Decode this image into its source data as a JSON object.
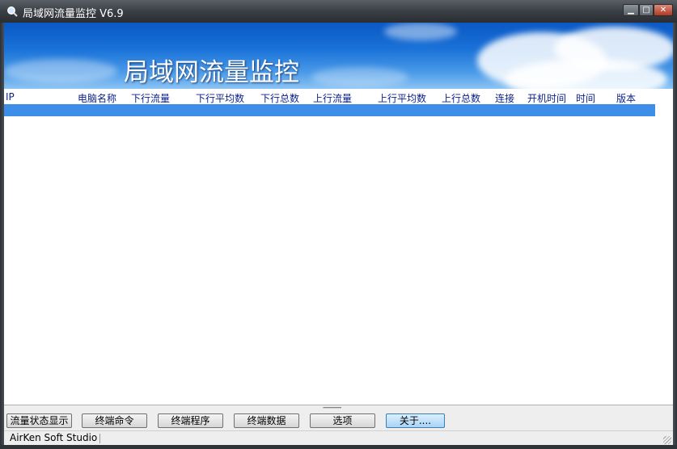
{
  "window": {
    "title": "局域网流量监控 V6.9",
    "controls": {
      "minimize": "▁",
      "maximize": "□",
      "close": "✕"
    }
  },
  "banner": {
    "title": "局域网流量监控"
  },
  "list": {
    "columns": [
      "IP",
      "电脑名称",
      "下行流量",
      "下行平均数",
      "下行总数",
      "上行流量",
      "上行平均数",
      "上行总数",
      "连接",
      "开机时间",
      "时间",
      "版本"
    ]
  },
  "splitter": {
    "grip": "----------"
  },
  "buttons": {
    "flow_status": "流量状态显示",
    "terminal_command": "终端命令",
    "terminal_program": "终端程序",
    "terminal_data": "终端数据",
    "options": "选项",
    "about": "关于...."
  },
  "status": {
    "text": "AirKen Soft Studio"
  },
  "colors": {
    "header_text": "#0a1f8c",
    "selection": "#3d8ee8",
    "banner_sky": "#1a72d8"
  }
}
